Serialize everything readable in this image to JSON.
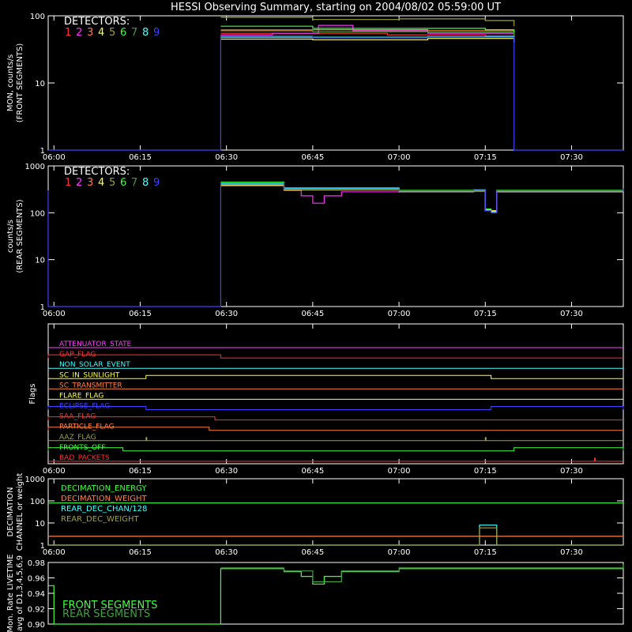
{
  "title": "HESSI Observing Summary, starting on 2004/08/02 05:59:00 UT",
  "colors": {
    "background": "#000000",
    "axes": "#ffffff",
    "det1": "#ff3030",
    "det2": "#ff30ff",
    "det3": "#ff8040",
    "det4": "#ffff40",
    "det5": "#a0a040",
    "det6": "#40ff40",
    "det7": "#40a040",
    "det8": "#40ffff",
    "det9": "#4040ff"
  },
  "chart_data": [
    {
      "id": "front",
      "type": "line",
      "ylabel": [
        "MON, counts/s",
        "(FRONT SEGMENTS)"
      ],
      "yscale": "log",
      "ylim": [
        1,
        100
      ],
      "yticks": [
        "1",
        "10",
        "100"
      ],
      "xlim": [
        "05:59",
        "07:39"
      ],
      "xticks": [
        "06:00",
        "06:15",
        "06:30",
        "06:45",
        "07:00",
        "07:15",
        "07:30"
      ],
      "legend_title": "DETECTORS:",
      "legend_items": [
        "1",
        "2",
        "3",
        "4",
        "5",
        "6",
        "7",
        "8",
        "9"
      ],
      "series": [
        {
          "color": "#ff3030",
          "points": [
            [
              "06:29",
              55
            ],
            [
              "06:45",
              55
            ],
            [
              "06:58",
              52
            ],
            [
              "07:15",
              50
            ],
            [
              "07:20",
              45
            ]
          ]
        },
        {
          "color": "#ff30ff",
          "points": [
            [
              "06:29",
              52
            ],
            [
              "06:38",
              55
            ],
            [
              "06:46",
              72
            ],
            [
              "06:52",
              60
            ],
            [
              "07:05",
              55
            ],
            [
              "07:20",
              40
            ]
          ]
        },
        {
          "color": "#ff8040",
          "points": [
            [
              "06:29",
              60
            ],
            [
              "06:45",
              62
            ],
            [
              "07:05",
              60
            ],
            [
              "07:20",
              55
            ]
          ]
        },
        {
          "color": "#ffff40",
          "points": [
            [
              "06:29",
              45
            ],
            [
              "06:45",
              44
            ],
            [
              "07:05",
              46
            ],
            [
              "07:20",
              40
            ]
          ]
        },
        {
          "color": "#a0a040",
          "points": [
            [
              "06:29",
              95
            ],
            [
              "06:45",
              88
            ],
            [
              "07:00",
              90
            ],
            [
              "07:15",
              85
            ],
            [
              "07:20",
              70
            ]
          ]
        },
        {
          "color": "#40ff40",
          "points": [
            [
              "06:29",
              70
            ],
            [
              "06:45",
              65
            ],
            [
              "07:00",
              65
            ],
            [
              "07:15",
              62
            ],
            [
              "07:20",
              55
            ]
          ]
        },
        {
          "color": "#40a040",
          "points": [
            [
              "06:29",
              62
            ],
            [
              "06:45",
              58
            ],
            [
              "07:05",
              57
            ],
            [
              "07:20",
              50
            ]
          ]
        },
        {
          "color": "#40ffff",
          "points": [
            [
              "06:29",
              48
            ],
            [
              "06:45",
              48
            ],
            [
              "07:05",
              49
            ],
            [
              "07:20",
              42
            ]
          ]
        },
        {
          "color": "#4040ff",
          "points": [
            [
              "05:59",
              1
            ],
            [
              "06:29",
              1
            ],
            [
              "06:29",
              50
            ],
            [
              "06:45",
              47
            ],
            [
              "07:05",
              48
            ],
            [
              "07:20",
              35
            ],
            [
              "07:20",
              1
            ],
            [
              "07:39",
              1
            ]
          ]
        }
      ]
    },
    {
      "id": "rear",
      "type": "line",
      "ylabel": [
        "counts/s",
        "(REAR SEGMENTS)"
      ],
      "yscale": "log",
      "ylim": [
        1,
        1000
      ],
      "yticks": [
        "1",
        "10",
        "100",
        "1000"
      ],
      "xlim": [
        "05:59",
        "07:39"
      ],
      "xticks": [
        "06:00",
        "06:15",
        "06:30",
        "06:45",
        "07:00",
        "07:15",
        "07:30"
      ],
      "legend_title": "DETECTORS:",
      "legend_items": [
        "1",
        "2",
        "3",
        "4",
        "5",
        "6",
        "7",
        "8",
        "9"
      ],
      "series": [
        {
          "color": "#40ff40",
          "points": [
            [
              "06:29",
              450
            ],
            [
              "06:40",
              340
            ],
            [
              "07:00",
              300
            ],
            [
              "07:13",
              310
            ],
            [
              "07:15",
              120
            ],
            [
              "07:16",
              110
            ],
            [
              "07:17",
              300
            ],
            [
              "07:39",
              330
            ]
          ]
        },
        {
          "color": "#40ffff",
          "points": [
            [
              "06:29",
              420
            ],
            [
              "06:40",
              330
            ],
            [
              "07:00",
              290
            ],
            [
              "07:13",
              300
            ],
            [
              "07:15",
              115
            ],
            [
              "07:16",
              105
            ],
            [
              "07:17",
              290
            ],
            [
              "07:39",
              320
            ]
          ]
        },
        {
          "color": "#ff30ff",
          "points": [
            [
              "06:29",
              400
            ],
            [
              "06:40",
              300
            ],
            [
              "06:43",
              230
            ],
            [
              "06:45",
              160
            ],
            [
              "06:47",
              230
            ],
            [
              "06:50",
              280
            ],
            [
              "07:00",
              290
            ],
            [
              "07:13",
              290
            ],
            [
              "07:15",
              110
            ],
            [
              "07:16",
              100
            ],
            [
              "07:17",
              280
            ],
            [
              "07:39",
              310
            ]
          ]
        },
        {
          "color": "#ffff40",
          "points": [
            [
              "06:29",
              380
            ],
            [
              "06:40",
              310
            ],
            [
              "07:00",
              280
            ],
            [
              "07:13",
              290
            ],
            [
              "07:15",
              110
            ],
            [
              "07:17",
              280
            ],
            [
              "07:39",
              300
            ]
          ]
        },
        {
          "color": "#4040ff",
          "points": [
            [
              "05:59",
              300
            ],
            [
              "05:59",
              1
            ],
            [
              "06:29",
              1
            ],
            [
              "06:29",
              430
            ],
            [
              "06:40",
              320
            ],
            [
              "07:00",
              290
            ],
            [
              "07:13",
              300
            ],
            [
              "07:15",
              110
            ],
            [
              "07:16",
              100
            ],
            [
              "07:17",
              290
            ],
            [
              "07:39",
              320
            ]
          ]
        }
      ]
    },
    {
      "id": "flags",
      "type": "line",
      "ylabel": [
        "Flags"
      ],
      "xlim": [
        "05:59",
        "07:39"
      ],
      "xticks": [
        "06:00",
        "06:15",
        "06:30",
        "06:45",
        "07:00",
        "07:15",
        "07:30"
      ],
      "flags": [
        {
          "label": "ATTENUATOR_STATE",
          "color": "#ff40ff",
          "on": []
        },
        {
          "label": "GAP_FLAG",
          "color": "#ff3030",
          "on": [
            [
              "05:59",
              "06:29"
            ]
          ]
        },
        {
          "label": "NON_SOLAR_EVENT",
          "color": "#40ffff",
          "on": []
        },
        {
          "label": "SC_IN_SUNLIGHT",
          "color": "#ffff40",
          "on": [
            [
              "06:16",
              "07:16"
            ]
          ]
        },
        {
          "label": "SC_TRANSMITTER",
          "color": "#ff8040",
          "on": []
        },
        {
          "label": "FLARE_FLAG",
          "color": "#ffff40",
          "on": []
        },
        {
          "label": "ECLIPSE_FLAG",
          "color": "#4040ff",
          "on": [
            [
              "05:59",
              "06:16"
            ],
            [
              "07:16",
              "07:39"
            ]
          ]
        },
        {
          "label": "SAA_FLAG",
          "color": "#ff3030",
          "on": [
            [
              "05:59",
              "06:28"
            ]
          ]
        },
        {
          "label": "PARTICLE_FLAG",
          "color": "#ff8040",
          "on": [
            [
              "05:59",
              "06:27"
            ]
          ]
        },
        {
          "label": "AAZ_FLAG",
          "color": "#a0a040",
          "on": [
            [
              "06:16",
              "06:16"
            ],
            [
              "07:15",
              "07:15"
            ]
          ]
        },
        {
          "label": "FRONTS_OFF",
          "color": "#40ff40",
          "on": [
            [
              "05:59",
              "06:12"
            ],
            [
              "07:20",
              "07:39"
            ]
          ]
        },
        {
          "label": "BAD_PACKETS",
          "color": "#ff3030",
          "on": [
            [
              "07:34",
              "07:34"
            ]
          ]
        }
      ]
    },
    {
      "id": "decimation",
      "type": "line",
      "ylabel": [
        "DECIMATION",
        "CHANNEL or weight"
      ],
      "yscale": "log",
      "ylim": [
        1,
        1000
      ],
      "yticks": [
        "1",
        "10",
        "100",
        "1000"
      ],
      "xlim": [
        "05:59",
        "07:39"
      ],
      "xticks": [
        "06:00",
        "06:15",
        "06:30",
        "06:45",
        "07:00",
        "07:15",
        "07:30"
      ],
      "legend_items": [
        "DECIMATION_ENERGY",
        "DECIMATION_WEIGHT",
        "REAR_DEC_CHAN/128",
        "REAR_DEC_WEIGHT"
      ],
      "series": [
        {
          "color": "#40ff40",
          "points": [
            [
              "05:59",
              80
            ],
            [
              "07:39",
              80
            ]
          ]
        },
        {
          "color": "#ff8040",
          "points": [
            [
              "05:59",
              2.5
            ],
            [
              "07:39",
              2.5
            ]
          ]
        },
        {
          "color": "#40ffff",
          "points": [
            [
              "05:59",
              1
            ],
            [
              "07:14",
              1
            ],
            [
              "07:14",
              8
            ],
            [
              "07:17",
              8
            ],
            [
              "07:17",
              1
            ],
            [
              "07:39",
              1
            ]
          ]
        },
        {
          "color": "#a0a040",
          "points": [
            [
              "05:59",
              1
            ],
            [
              "07:14",
              1
            ],
            [
              "07:14",
              6
            ],
            [
              "07:17",
              6
            ],
            [
              "07:17",
              1
            ],
            [
              "07:39",
              1
            ]
          ]
        }
      ]
    },
    {
      "id": "livetime",
      "type": "line",
      "ylabel": [
        "Mon. Rate LIVETIME",
        "avg of D1,3,4,5,6,9"
      ],
      "ylim": [
        0.9,
        0.98
      ],
      "yticks": [
        "0.90",
        "0.92",
        "0.94",
        "0.96",
        "0.98"
      ],
      "xlim": [
        "05:59",
        "07:39"
      ],
      "legend_items": [
        "FRONT SEGMENTS",
        "REAR SEGMENTS"
      ],
      "series": [
        {
          "color": "#40ff40",
          "points": [
            [
              "05:59",
              0.95
            ],
            [
              "06:00",
              0.95
            ],
            [
              "06:00",
              0.9
            ],
            [
              "06:29",
              0.9
            ],
            [
              "06:29",
              0.972
            ],
            [
              "06:40",
              0.968
            ],
            [
              "06:43",
              0.962
            ],
            [
              "06:45",
              0.952
            ],
            [
              "06:47",
              0.962
            ],
            [
              "06:50",
              0.968
            ],
            [
              "07:00",
              0.972
            ],
            [
              "07:39",
              0.978
            ]
          ]
        },
        {
          "color": "#40a040",
          "points": [
            [
              "06:29",
              0.973
            ],
            [
              "06:40",
              0.969
            ],
            [
              "06:45",
              0.955
            ],
            [
              "06:50",
              0.969
            ],
            [
              "07:00",
              0.973
            ],
            [
              "07:39",
              0.977
            ]
          ]
        }
      ]
    }
  ]
}
